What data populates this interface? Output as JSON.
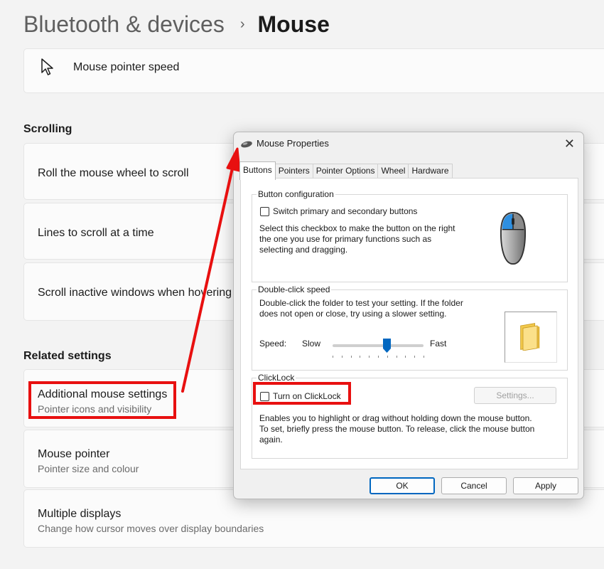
{
  "breadcrumb": {
    "parent": "Bluetooth & devices",
    "separator": "›",
    "current": "Mouse"
  },
  "pointer_speed": {
    "label": "Mouse pointer speed",
    "icon": "mouse-pointer-icon"
  },
  "scrolling": {
    "heading": "Scrolling",
    "items": [
      {
        "label": "Roll the mouse wheel to scroll"
      },
      {
        "label": "Lines to scroll at a time"
      },
      {
        "label": "Scroll inactive windows when hovering"
      }
    ]
  },
  "related": {
    "heading": "Related settings",
    "items": [
      {
        "title": "Additional mouse settings",
        "subtitle": "Pointer icons and visibility"
      },
      {
        "title": "Mouse pointer",
        "subtitle": "Pointer size and colour"
      },
      {
        "title": "Multiple displays",
        "subtitle": "Change how cursor moves over display boundaries"
      }
    ]
  },
  "dialog": {
    "title": "Mouse Properties",
    "close_glyph": "✕",
    "tabs": [
      "Buttons",
      "Pointers",
      "Pointer Options",
      "Wheel",
      "Hardware"
    ],
    "active_tab": "Buttons",
    "button_config": {
      "label": "Button configuration",
      "checkbox_label": "Switch primary and secondary buttons",
      "checked": false,
      "description": [
        "Select this checkbox to make the button on the right",
        "the one you use for primary functions such as",
        "selecting and dragging."
      ]
    },
    "double_click": {
      "label": "Double-click speed",
      "description": [
        "Double-click the folder to test your setting. If the folder",
        "does not open or close, try using a slower setting."
      ],
      "speed_label": "Speed:",
      "slow_label": "Slow",
      "fast_label": "Fast",
      "speed_value": 0.6
    },
    "clicklock": {
      "label": "ClickLock",
      "checkbox_label": "Turn on ClickLock",
      "checked": false,
      "settings_button": "Settings...",
      "description": [
        "Enables you to highlight or drag without holding down the mouse button.",
        "To set, briefly press the mouse button. To release, click the mouse button",
        "again."
      ]
    },
    "buttons": {
      "ok": "OK",
      "cancel": "Cancel",
      "apply": "Apply"
    }
  },
  "colors": {
    "highlight_red": "#e81010",
    "accent_blue": "#0067c0",
    "page_bg": "#f3f3f3",
    "card_bg": "#fbfbfb"
  }
}
